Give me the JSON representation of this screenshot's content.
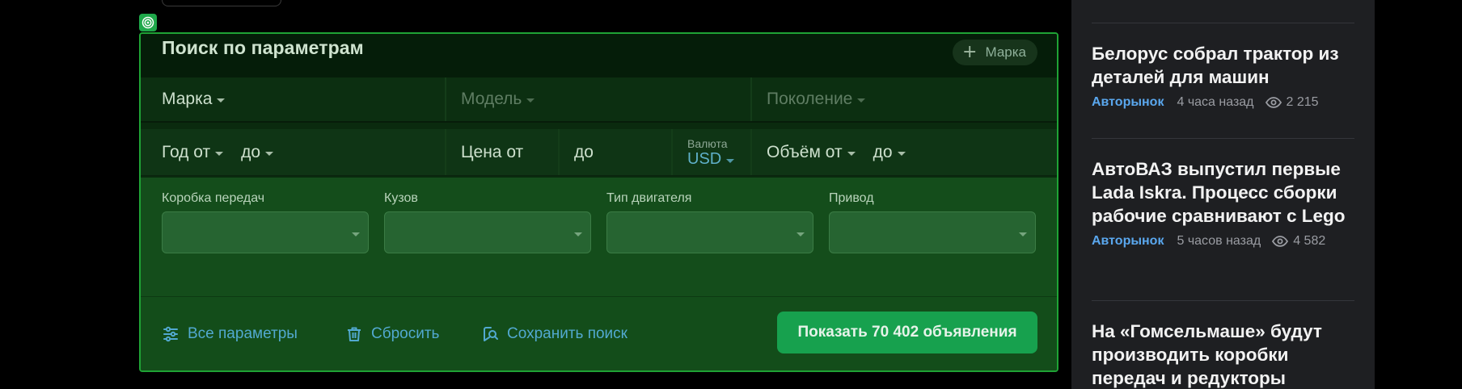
{
  "search_panel": {
    "title": "Поиск по параметрам",
    "add_brand_label": "Марка",
    "row1": {
      "brand": "Марка",
      "model": "Модель",
      "generation": "Поколение"
    },
    "row2": {
      "year_from": "Год от",
      "year_to": "до",
      "price_from": "Цена от",
      "price_to": "до",
      "currency_caption": "Валюта",
      "currency_value": "USD",
      "volume_from": "Объём от",
      "volume_to": "до"
    },
    "filters": [
      {
        "label": "Коробка передач",
        "value": ""
      },
      {
        "label": "Кузов",
        "value": ""
      },
      {
        "label": "Тип двигателя",
        "value": ""
      },
      {
        "label": "Привод",
        "value": ""
      }
    ],
    "footer": {
      "all_params": "Все параметры",
      "reset": "Сбросить",
      "save_search": "Сохранить поиск",
      "show_button": "Показать 70 402 объявления"
    }
  },
  "news": [
    {
      "title": "Белорус собрал трактор из деталей для машин",
      "category": "Авторынок",
      "time": "4 часа назад",
      "views": "2 215"
    },
    {
      "title": "АвтоВАЗ выпустил первые Lada Iskra. Процесс сборки рабочие сравнивают с Lego",
      "category": "Авторынок",
      "time": "5 часов назад",
      "views": "4 582"
    },
    {
      "title": "На «Гомсельмаше» будут производить коробки передач и редукторы",
      "category": "",
      "time": "",
      "views": ""
    }
  ],
  "colors": {
    "panel_border": "#1fa335",
    "accent_link": "#52a9d0",
    "show_button": "#17a14e",
    "news_category": "#5aa7ee"
  },
  "icons": {
    "target": "target-icon",
    "add": "plus-icon",
    "all_params": "sliders-icon",
    "reset": "trash-icon",
    "save_search": "save-search-icon",
    "views": "eye-icon"
  }
}
